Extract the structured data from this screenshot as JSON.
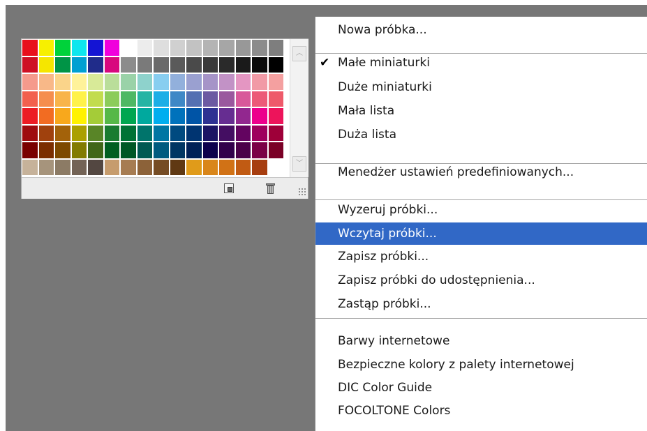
{
  "swatches": {
    "rows": [
      [
        "#e8101c",
        "#f7f000",
        "#00d23a",
        "#0ee6ee",
        "#1414d4",
        "#f000dc",
        "#ffffff",
        "#ececec",
        "#dedede",
        "#d0d0d0",
        "#c2c2c2",
        "#b4b4b4",
        "#a6a6a6",
        "#989898",
        "#8c8c8c",
        "#7e7e7e"
      ],
      [
        "#ce1024",
        "#f5e600",
        "#009446",
        "#00a0d2",
        "#202c8a",
        "#d8087e",
        "#8c8c8c",
        "#7a7a7a",
        "#6a6a6a",
        "#5a5a5a",
        "#4a4a4a",
        "#3a3a3a",
        "#2a2a2a",
        "#1a1a1a",
        "#0a0a0a",
        "#000000"
      ],
      [
        "#f59a8c",
        "#f8b888",
        "#fad48a",
        "#fff29a",
        "#d8ea98",
        "#bade9a",
        "#9ad2a8",
        "#8ed2cc",
        "#88cef0",
        "#92b0dc",
        "#9aa0d0",
        "#a694c8",
        "#c292c6",
        "#e496c2",
        "#f19aa6",
        "#f4a0a0"
      ],
      [
        "#f2604e",
        "#f58e4e",
        "#f8b44a",
        "#fff24a",
        "#c2dc4e",
        "#8ccc5a",
        "#4eb864",
        "#26b4a4",
        "#1caee6",
        "#3e88c6",
        "#5470b2",
        "#6c5aa2",
        "#9a589e",
        "#d8589a",
        "#ec5a78",
        "#ee5a6a"
      ],
      [
        "#ec1c24",
        "#f26c22",
        "#f8a81c",
        "#fff200",
        "#a4cc38",
        "#56b848",
        "#00a650",
        "#00a99e",
        "#00aeef",
        "#0072bc",
        "#0054a6",
        "#2e3192",
        "#662d91",
        "#92278f",
        "#ec008c",
        "#ed145b"
      ],
      [
        "#9e0b0f",
        "#a0410d",
        "#a3620a",
        "#aba000",
        "#598527",
        "#197b30",
        "#007236",
        "#00746b",
        "#0076a3",
        "#004a80",
        "#003471",
        "#1b1464",
        "#440e62",
        "#630460",
        "#9e005d",
        "#9e0039"
      ],
      [
        "#790000",
        "#7b2e00",
        "#7d4900",
        "#827b00",
        "#406618",
        "#005e20",
        "#005826",
        "#005952",
        "#005b7f",
        "#003663",
        "#002157",
        "#0d004c",
        "#32004b",
        "#4b0049",
        "#7b0046",
        "#7a0026"
      ],
      [
        "#c6b29a",
        "#a6947c",
        "#8c7b65",
        "#736356",
        "#534741",
        "#c69c6d",
        "#a67c52",
        "#8c6239",
        "#754c24",
        "#603913",
        "#e09b1a",
        "#d9861a",
        "#d17216",
        "#c15b13",
        "#a73e10"
      ]
    ]
  },
  "panel": {
    "scroll_up_icon": "chevron-up-icon",
    "scroll_down_icon": "chevron-down-icon",
    "new_swatch_icon": "new-swatch-icon",
    "delete_icon": "trash-icon",
    "grip_icon": "resize-grip-icon"
  },
  "menu": {
    "accent": "#3168c6",
    "items": [
      {
        "label": "Nowa próbka...",
        "checked": false,
        "highlighted": false
      },
      {
        "label": "Małe miniaturki",
        "checked": true,
        "highlighted": false
      },
      {
        "label": "Duże miniaturki",
        "checked": false,
        "highlighted": false
      },
      {
        "label": "Mała lista",
        "checked": false,
        "highlighted": false
      },
      {
        "label": "Duża lista",
        "checked": false,
        "highlighted": false
      },
      {
        "label": "Menedżer ustawień predefiniowanych...",
        "checked": false,
        "highlighted": false
      },
      {
        "label": "Wyzeruj próbki...",
        "checked": false,
        "highlighted": false
      },
      {
        "label": "Wczytaj próbki...",
        "checked": false,
        "highlighted": true
      },
      {
        "label": "Zapisz próbki...",
        "checked": false,
        "highlighted": false
      },
      {
        "label": "Zapisz próbki do udostępnienia...",
        "checked": false,
        "highlighted": false
      },
      {
        "label": "Zastąp próbki...",
        "checked": false,
        "highlighted": false
      },
      {
        "label": "Barwy internetowe",
        "checked": false,
        "highlighted": false
      },
      {
        "label": "Bezpieczne kolory z palety internetowej",
        "checked": false,
        "highlighted": false
      },
      {
        "label": "DIC Color Guide",
        "checked": false,
        "highlighted": false
      },
      {
        "label": "FOCOLTONE Colors",
        "checked": false,
        "highlighted": false
      }
    ],
    "check_glyph": "✔"
  }
}
